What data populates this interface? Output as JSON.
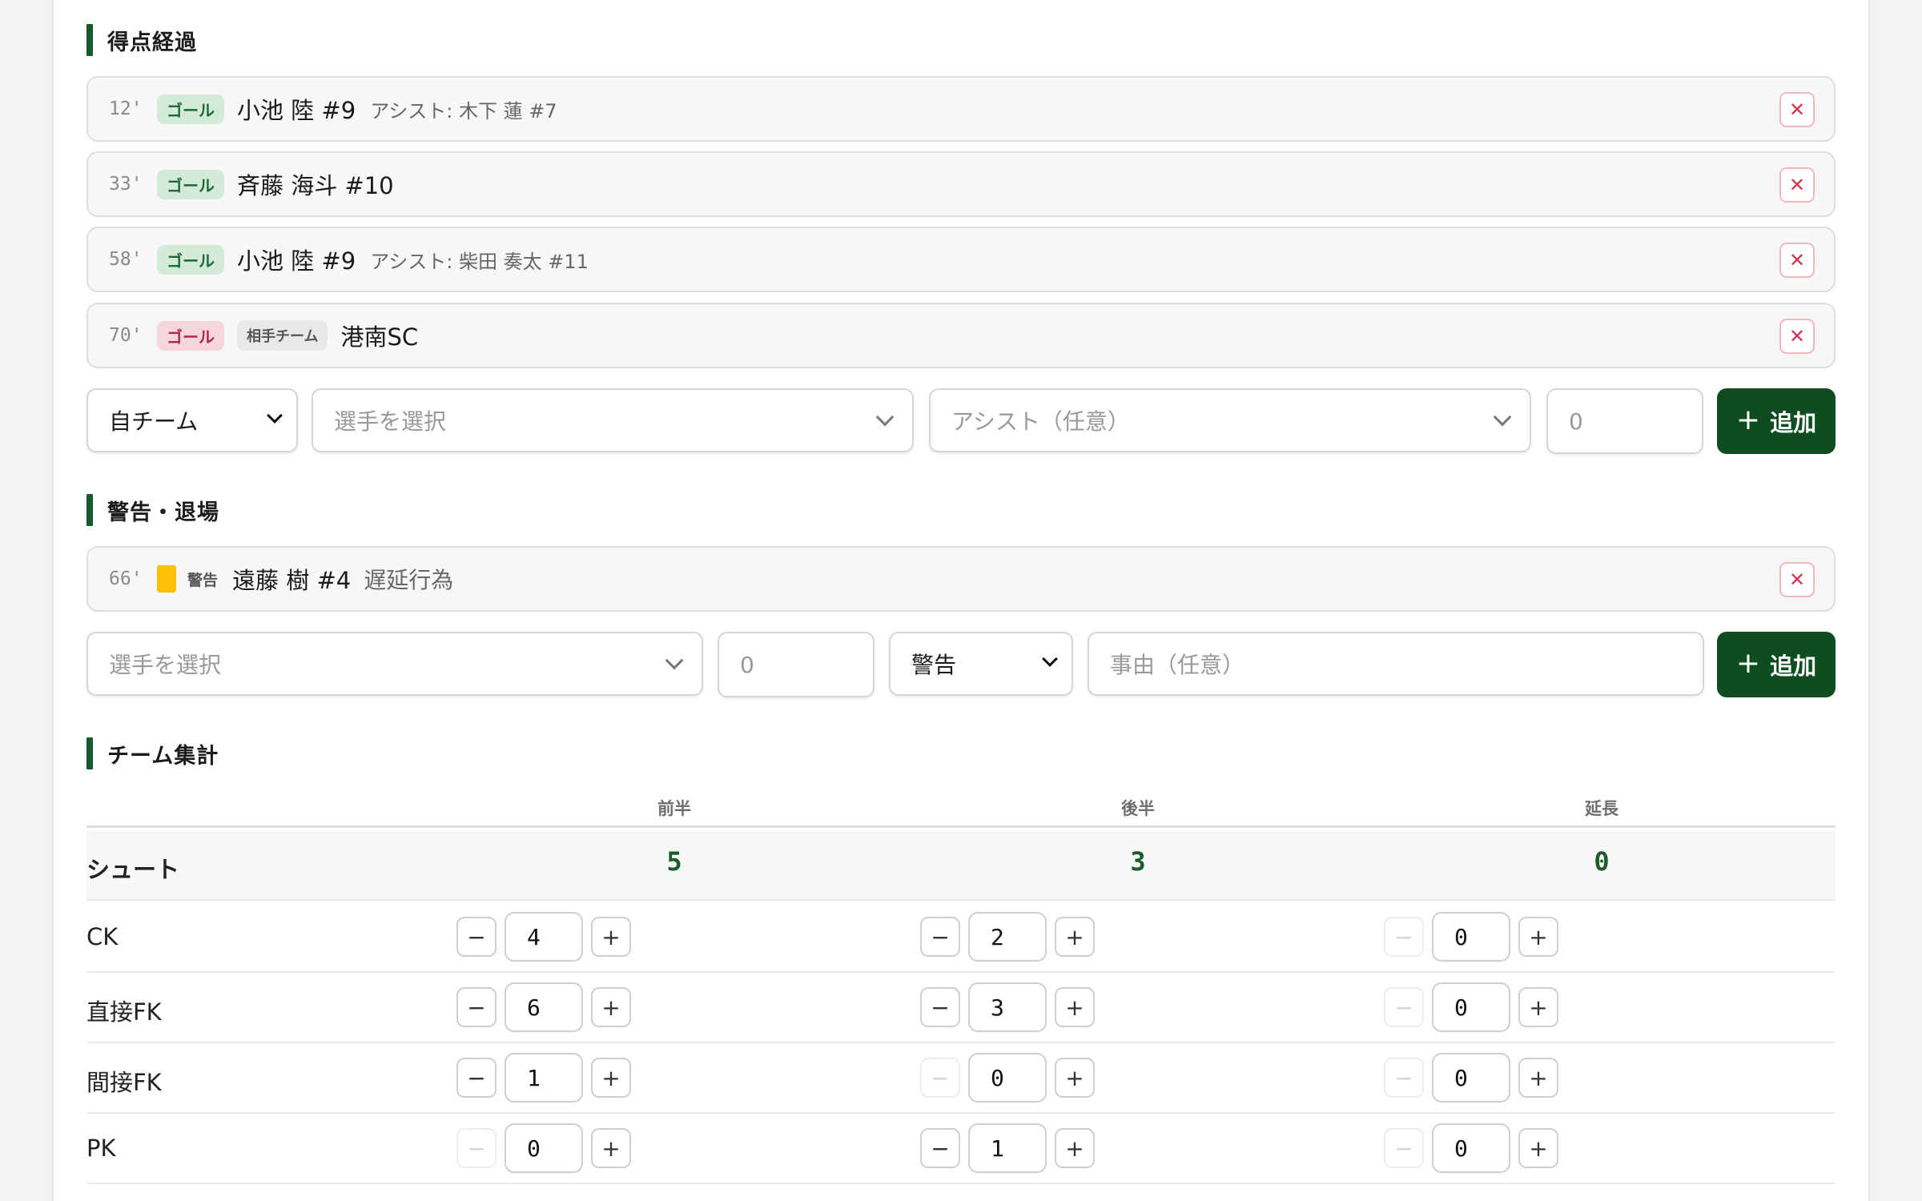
{
  "sections": {
    "goals_title": "得点経過",
    "cards_title": "警告・退場",
    "stats_title": "チーム集計"
  },
  "goals": [
    {
      "minute": "12'",
      "badge": "ゴール",
      "player": "小池 陸 #9",
      "assist": "アシスト: 木下 蓮 #7"
    },
    {
      "minute": "33'",
      "badge": "ゴール",
      "player": "斉藤 海斗 #10",
      "assist": ""
    },
    {
      "minute": "58'",
      "badge": "ゴール",
      "player": "小池 陸 #9",
      "assist": "アシスト: 柴田 奏太 #11"
    },
    {
      "minute": "70'",
      "badge": "ゴール",
      "opp_badge": "相手チーム",
      "player": "港南SC"
    }
  ],
  "goal_form": {
    "team": "自チーム",
    "player_placeholder": "選手を選択",
    "assist_placeholder": "アシスト（任意）",
    "minute_placeholder": "0",
    "add_label": "追加"
  },
  "cards": [
    {
      "minute": "66'",
      "type": "警告",
      "player": "遠藤 樹 #4",
      "reason": "遅延行為",
      "color": "#fbc106"
    }
  ],
  "card_form": {
    "player_placeholder": "選手を選択",
    "minute_placeholder": "0",
    "type": "警告",
    "reason_placeholder": "事由（任意）",
    "add_label": "追加"
  },
  "stats": {
    "columns": [
      "前半",
      "後半",
      "延長"
    ],
    "shot": {
      "label": "シュート",
      "values": [
        "5",
        "3",
        "0"
      ]
    },
    "rows": [
      {
        "label": "CK",
        "values": [
          "4",
          "2",
          "0"
        ]
      },
      {
        "label": "直接FK",
        "values": [
          "6",
          "3",
          "0"
        ]
      },
      {
        "label": "間接FK",
        "values": [
          "1",
          "0",
          "0"
        ]
      },
      {
        "label": "PK",
        "values": [
          "0",
          "1",
          "0"
        ]
      }
    ]
  },
  "icons": {
    "delete": "close-icon",
    "add": "plus-icon",
    "minus": "minus-icon",
    "plus": "plus-icon",
    "dropdown": "chevron-down-icon"
  },
  "colors": {
    "accent": "#155a2a",
    "add_button": "#0e4d1f",
    "yellow_card": "#fbc106",
    "delete": "#d1344f"
  }
}
